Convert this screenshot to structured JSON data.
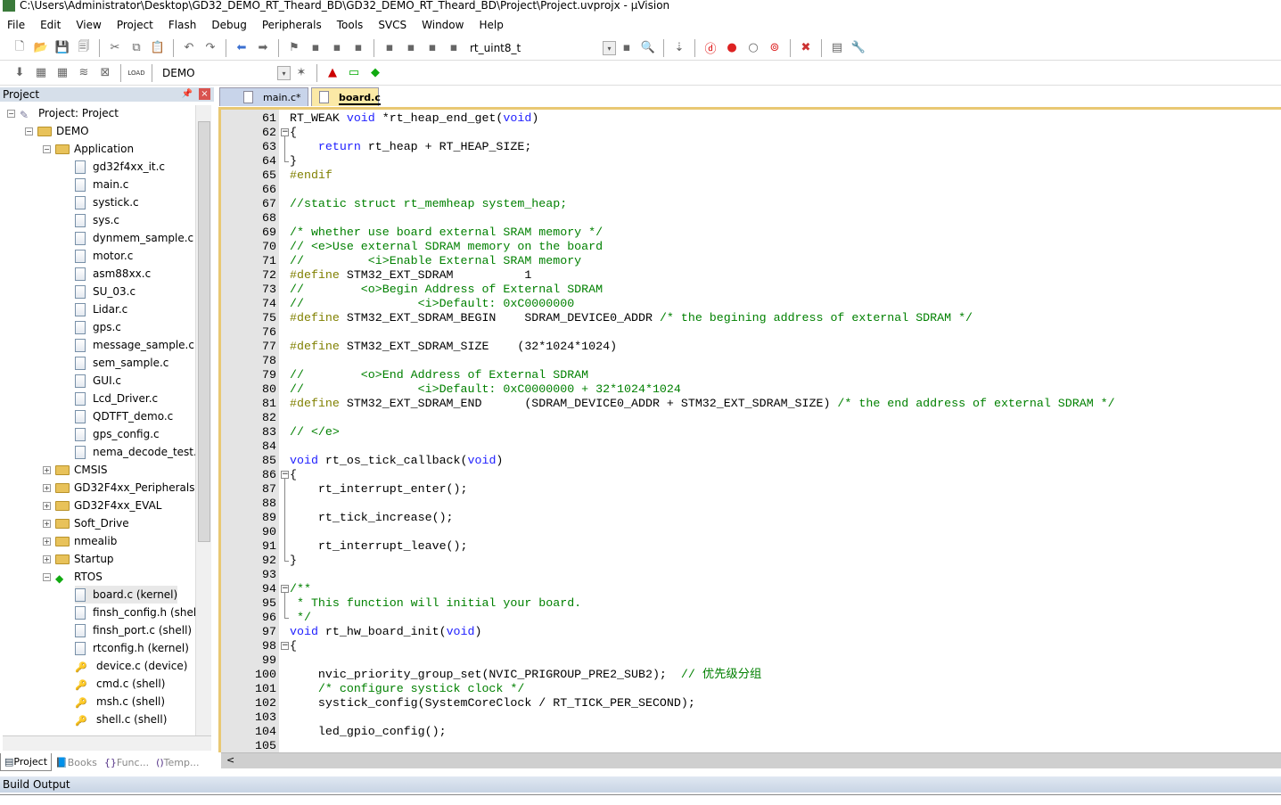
{
  "window": {
    "title": "C:\\Users\\Administrator\\Desktop\\GD32_DEMO_RT_Theard_BD\\GD32_DEMO_RT_Theard_BD\\Project\\Project.uvprojx - µVision",
    "logo": "V5"
  },
  "menu": [
    "File",
    "Edit",
    "View",
    "Project",
    "Flash",
    "Debug",
    "Peripherals",
    "Tools",
    "SVCS",
    "Window",
    "Help"
  ],
  "toolbar1": {
    "find_combo": "rt_uint8_t",
    "icons": [
      "new-file",
      "open",
      "save",
      "save-all",
      "cut",
      "copy",
      "paste",
      "undo",
      "redo",
      "nav-back",
      "nav-forward",
      "bookmark",
      "bookmark-prev",
      "bookmark-next",
      "bookmark-clear",
      "indent",
      "unindent",
      "comment",
      "uncomment",
      "find-in-files",
      "find",
      "incremental-find",
      "debug-session",
      "breakpoint",
      "disable-breakpoint",
      "enable-breakpoints",
      "kill-breakpoints",
      "window-layout",
      "configure"
    ]
  },
  "toolbar2": {
    "target": "DEMO",
    "load_label": "LOAD",
    "icons": [
      "translate",
      "build",
      "rebuild",
      "batch-build",
      "stop-build",
      "download",
      "target-options",
      "manage-components",
      "select-packs",
      "pack-installer"
    ]
  },
  "project_panel": {
    "title": "Project",
    "tree": [
      {
        "label": "Project: Project",
        "level": 0,
        "type": "root",
        "expanded": true
      },
      {
        "label": "DEMO",
        "level": 1,
        "type": "target",
        "expanded": true
      },
      {
        "label": "Application",
        "level": 2,
        "type": "folder",
        "expanded": true
      },
      {
        "label": "gd32f4xx_it.c",
        "level": 3,
        "type": "file"
      },
      {
        "label": "main.c",
        "level": 3,
        "type": "file"
      },
      {
        "label": "systick.c",
        "level": 3,
        "type": "file"
      },
      {
        "label": "sys.c",
        "level": 3,
        "type": "file"
      },
      {
        "label": "dynmem_sample.c",
        "level": 3,
        "type": "file"
      },
      {
        "label": "motor.c",
        "level": 3,
        "type": "file"
      },
      {
        "label": "asm88xx.c",
        "level": 3,
        "type": "file"
      },
      {
        "label": "SU_03.c",
        "level": 3,
        "type": "file"
      },
      {
        "label": "Lidar.c",
        "level": 3,
        "type": "file"
      },
      {
        "label": "gps.c",
        "level": 3,
        "type": "file"
      },
      {
        "label": "message_sample.c",
        "level": 3,
        "type": "file"
      },
      {
        "label": "sem_sample.c",
        "level": 3,
        "type": "file"
      },
      {
        "label": "GUI.c",
        "level": 3,
        "type": "file"
      },
      {
        "label": "Lcd_Driver.c",
        "level": 3,
        "type": "file"
      },
      {
        "label": "QDTFT_demo.c",
        "level": 3,
        "type": "file"
      },
      {
        "label": "gps_config.c",
        "level": 3,
        "type": "file"
      },
      {
        "label": "nema_decode_test.c",
        "level": 3,
        "type": "file"
      },
      {
        "label": "CMSIS",
        "level": 2,
        "type": "folder",
        "expanded": false
      },
      {
        "label": "GD32F4xx_Peripherals",
        "level": 2,
        "type": "folder",
        "expanded": false
      },
      {
        "label": "GD32F4xx_EVAL",
        "level": 2,
        "type": "folder",
        "expanded": false
      },
      {
        "label": "Soft_Drive",
        "level": 2,
        "type": "folder",
        "expanded": false
      },
      {
        "label": "nmealib",
        "level": 2,
        "type": "folder",
        "expanded": false
      },
      {
        "label": "Startup",
        "level": 2,
        "type": "folder",
        "expanded": false
      },
      {
        "label": "RTOS",
        "level": 2,
        "type": "component",
        "expanded": true
      },
      {
        "label": "board.c (kernel)",
        "level": 3,
        "type": "file",
        "selected": true
      },
      {
        "label": "finsh_config.h (shell)",
        "level": 3,
        "type": "file"
      },
      {
        "label": "finsh_port.c (shell)",
        "level": 3,
        "type": "file"
      },
      {
        "label": "rtconfig.h (kernel)",
        "level": 3,
        "type": "file"
      },
      {
        "label": "device.c (device)",
        "level": 3,
        "type": "keyfile"
      },
      {
        "label": "cmd.c (shell)",
        "level": 3,
        "type": "keyfile"
      },
      {
        "label": "msh.c (shell)",
        "level": 3,
        "type": "keyfile"
      },
      {
        "label": "shell.c (shell)",
        "level": 3,
        "type": "keyfile"
      }
    ],
    "tabs": [
      {
        "label": "Project",
        "active": true
      },
      {
        "label": "Books"
      },
      {
        "label": "Func..."
      },
      {
        "label": "Temp..."
      }
    ]
  },
  "editor": {
    "tabs": [
      {
        "label": "main.c*",
        "active": false
      },
      {
        "label": "board.c",
        "active": true
      }
    ],
    "colors": {
      "keyword": "#2020ff",
      "preprocessor": "#808000",
      "comment": "#008000"
    },
    "lines": [
      {
        "n": "61",
        "s": [
          [
            "n",
            "RT_WEAK "
          ],
          [
            "k",
            "void"
          ],
          [
            "n",
            " *rt_heap_end_get("
          ],
          [
            "k",
            "void"
          ],
          [
            "n",
            ")"
          ]
        ]
      },
      {
        "n": "62",
        "fold": "open",
        "s": [
          [
            "n",
            "{"
          ]
        ]
      },
      {
        "n": "63",
        "s": [
          [
            "n",
            "    "
          ],
          [
            "k",
            "return"
          ],
          [
            "n",
            " rt_heap + RT_HEAP_SIZE;"
          ]
        ]
      },
      {
        "n": "64",
        "s": [
          [
            "n",
            "}"
          ]
        ]
      },
      {
        "n": "65",
        "s": [
          [
            "p",
            "#endif"
          ]
        ]
      },
      {
        "n": "66",
        "s": []
      },
      {
        "n": "67",
        "s": [
          [
            "c",
            "//static struct rt_memheap system_heap;"
          ]
        ]
      },
      {
        "n": "68",
        "s": []
      },
      {
        "n": "69",
        "s": [
          [
            "c",
            "/* whether use board external SRAM memory */"
          ]
        ]
      },
      {
        "n": "70",
        "s": [
          [
            "c",
            "// <e>Use external SDRAM memory on the board"
          ]
        ]
      },
      {
        "n": "71",
        "s": [
          [
            "c",
            "//         <i>Enable External SRAM memory"
          ]
        ]
      },
      {
        "n": "72",
        "s": [
          [
            "p",
            "#define"
          ],
          [
            "n",
            " STM32_EXT_SDRAM          1"
          ]
        ]
      },
      {
        "n": "73",
        "s": [
          [
            "c",
            "//        <o>Begin Address of External SDRAM"
          ]
        ]
      },
      {
        "n": "74",
        "s": [
          [
            "c",
            "//                <i>Default: 0xC0000000"
          ]
        ]
      },
      {
        "n": "75",
        "s": [
          [
            "p",
            "#define"
          ],
          [
            "n",
            " STM32_EXT_SDRAM_BEGIN    SDRAM_DEVICE0_ADDR "
          ],
          [
            "c",
            "/* the begining address of external SDRAM */"
          ]
        ]
      },
      {
        "n": "76",
        "s": []
      },
      {
        "n": "77",
        "s": [
          [
            "p",
            "#define"
          ],
          [
            "n",
            " STM32_EXT_SDRAM_SIZE    (32*1024*1024)"
          ]
        ]
      },
      {
        "n": "78",
        "s": []
      },
      {
        "n": "79",
        "s": [
          [
            "c",
            "//        <o>End Address of External SDRAM"
          ]
        ]
      },
      {
        "n": "80",
        "s": [
          [
            "c",
            "//                <i>Default: 0xC0000000 + 32*1024*1024"
          ]
        ]
      },
      {
        "n": "81",
        "s": [
          [
            "p",
            "#define"
          ],
          [
            "n",
            " STM32_EXT_SDRAM_END      (SDRAM_DEVICE0_ADDR + STM32_EXT_SDRAM_SIZE) "
          ],
          [
            "c",
            "/* the end address of external SDRAM */"
          ]
        ]
      },
      {
        "n": "82",
        "s": []
      },
      {
        "n": "83",
        "s": [
          [
            "c",
            "// </e>"
          ]
        ]
      },
      {
        "n": "84",
        "s": []
      },
      {
        "n": "85",
        "s": [
          [
            "k",
            "void"
          ],
          [
            "n",
            " rt_os_tick_callback("
          ],
          [
            "k",
            "void"
          ],
          [
            "n",
            ")"
          ]
        ]
      },
      {
        "n": "86",
        "fold": "open",
        "s": [
          [
            "n",
            "{"
          ]
        ]
      },
      {
        "n": "87",
        "s": [
          [
            "n",
            "    rt_interrupt_enter();"
          ]
        ]
      },
      {
        "n": "88",
        "s": []
      },
      {
        "n": "89",
        "s": [
          [
            "n",
            "    rt_tick_increase();"
          ]
        ]
      },
      {
        "n": "90",
        "s": []
      },
      {
        "n": "91",
        "s": [
          [
            "n",
            "    rt_interrupt_leave();"
          ]
        ]
      },
      {
        "n": "92",
        "s": [
          [
            "n",
            "}"
          ]
        ]
      },
      {
        "n": "93",
        "s": []
      },
      {
        "n": "94",
        "fold": "open",
        "s": [
          [
            "c",
            "/**"
          ]
        ]
      },
      {
        "n": "95",
        "s": [
          [
            "c",
            " * This function will initial your board."
          ]
        ]
      },
      {
        "n": "96",
        "s": [
          [
            "c",
            " */"
          ]
        ]
      },
      {
        "n": "97",
        "s": [
          [
            "k",
            "void"
          ],
          [
            "n",
            " rt_hw_board_init("
          ],
          [
            "k",
            "void"
          ],
          [
            "n",
            ")"
          ]
        ]
      },
      {
        "n": "98",
        "fold": "open",
        "s": [
          [
            "n",
            "{"
          ]
        ]
      },
      {
        "n": "99",
        "s": []
      },
      {
        "n": "100",
        "s": [
          [
            "n",
            "    nvic_priority_group_set(NVIC_PRIGROUP_PRE2_SUB2);  "
          ],
          [
            "c",
            "// 优先级分组"
          ]
        ]
      },
      {
        "n": "101",
        "s": [
          [
            "c",
            "    /* configure systick clock */"
          ]
        ]
      },
      {
        "n": "102",
        "s": [
          [
            "n",
            "    systick_config(SystemCoreClock / RT_TICK_PER_SECOND);"
          ]
        ]
      },
      {
        "n": "103",
        "s": []
      },
      {
        "n": "104",
        "s": [
          [
            "n",
            "    led_gpio_config();"
          ]
        ]
      },
      {
        "n": "105",
        "s": []
      }
    ]
  },
  "build_output": {
    "title": "Build Output"
  }
}
